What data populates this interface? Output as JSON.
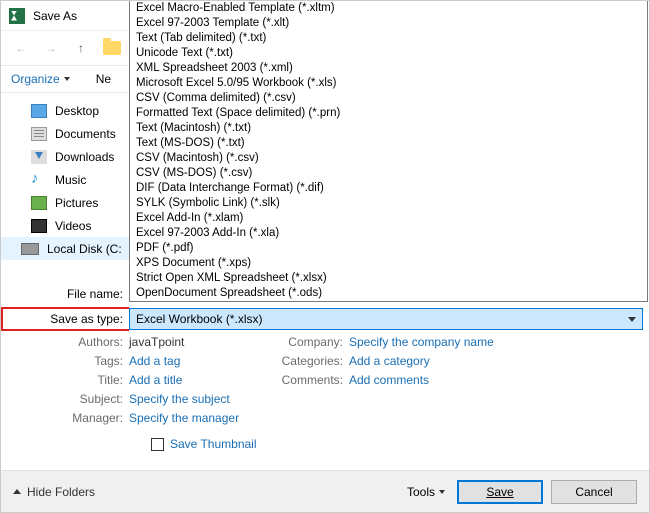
{
  "title": "Save As",
  "toolbar": {
    "organize": "Organize",
    "new": "Ne"
  },
  "sidebar": [
    {
      "label": "Desktop",
      "icon": "desktop"
    },
    {
      "label": "Documents",
      "icon": "docs"
    },
    {
      "label": "Downloads",
      "icon": "down"
    },
    {
      "label": "Music",
      "icon": "music"
    },
    {
      "label": "Pictures",
      "icon": "pics"
    },
    {
      "label": "Videos",
      "icon": "vids"
    },
    {
      "label": "Local Disk (C:",
      "icon": "disk"
    }
  ],
  "file_types": [
    "Excel Macro-Enabled Template (*.xltm)",
    "Excel 97-2003 Template (*.xlt)",
    "Text (Tab delimited) (*.txt)",
    "Unicode Text (*.txt)",
    "XML Spreadsheet 2003 (*.xml)",
    "Microsoft Excel 5.0/95 Workbook (*.xls)",
    "CSV (Comma delimited) (*.csv)",
    "Formatted Text (Space delimited) (*.prn)",
    "Text (Macintosh) (*.txt)",
    "Text (MS-DOS) (*.txt)",
    "CSV (Macintosh) (*.csv)",
    "CSV (MS-DOS) (*.csv)",
    "DIF (Data Interchange Format) (*.dif)",
    "SYLK (Symbolic Link) (*.slk)",
    "Excel Add-In (*.xlam)",
    "Excel 97-2003 Add-In (*.xla)",
    "PDF (*.pdf)",
    "XPS Document (*.xps)",
    "Strict Open XML Spreadsheet (*.xlsx)",
    "OpenDocument Spreadsheet (*.ods)"
  ],
  "labels": {
    "filename": "File name:",
    "savetype": "Save as type:",
    "authors": "Authors:",
    "tags": "Tags:",
    "title": "Title:",
    "subject": "Subject:",
    "manager": "Manager:",
    "company": "Company:",
    "categories": "Categories:",
    "comments": "Comments:",
    "thumb": "Save Thumbnail",
    "hide": "Hide Folders",
    "tools": "Tools",
    "save": "Save",
    "cancel": "Cancel"
  },
  "values": {
    "savetype": "Excel Workbook (*.xlsx)",
    "authors": "javaTpoint",
    "tags": "Add a tag",
    "title": "Add a title",
    "subject": "Specify the subject",
    "manager": "Specify the manager",
    "company": "Specify the company name",
    "categories": "Add a category",
    "comments": "Add comments"
  }
}
